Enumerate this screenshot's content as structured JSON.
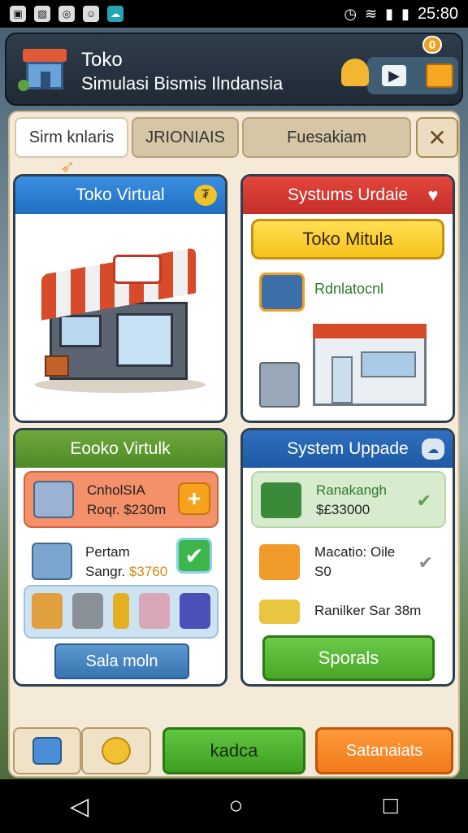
{
  "status_bar": {
    "time": "25:80",
    "icons": [
      "image-icon",
      "image-icon",
      "instagram-icon",
      "chat-icon",
      "cloud-icon",
      "alarm-icon",
      "wifi-icon",
      "signal-icon",
      "battery-icon"
    ]
  },
  "header": {
    "title": "Toko",
    "subtitle": "Simulasi Bismis Ilndansia",
    "badge": "0"
  },
  "tabs": [
    {
      "label": "Sirm knlaris"
    },
    {
      "label": "JRIONIAIS"
    },
    {
      "label": "Fuesakiam"
    }
  ],
  "panels": {
    "toko_virtual": {
      "title": "Toko Virtual"
    },
    "systems_update": {
      "title": "Systums Urdaie",
      "button_label": "Toko Mitula",
      "label": "Rdnlatocnl"
    },
    "eooko": {
      "title": "Eooko Virtulk",
      "items": [
        {
          "line1": "CnholSIA",
          "line2": "Roqr. $230m"
        },
        {
          "line1": "Pertam",
          "line2_prefix": "Sangr.",
          "price": "$3760"
        }
      ],
      "button_label": "Sala moln"
    },
    "system_upgrade": {
      "title": "System Uppade",
      "items": [
        {
          "line1": "Ranakangh",
          "line2": "$£33000"
        },
        {
          "line1": "Macatio: Oile",
          "line2": "S0"
        },
        {
          "line1": "Ranilker Sar 38m"
        }
      ],
      "button_label": "Sporals"
    }
  },
  "footer": {
    "green_button": "kadca",
    "orange_button": "Satanaiats"
  },
  "colors": {
    "primary_blue": "#1f6fc2",
    "red": "#c32f2a",
    "green": "#48a826",
    "orange": "#f07a1a",
    "yellow": "#f6c21a"
  }
}
